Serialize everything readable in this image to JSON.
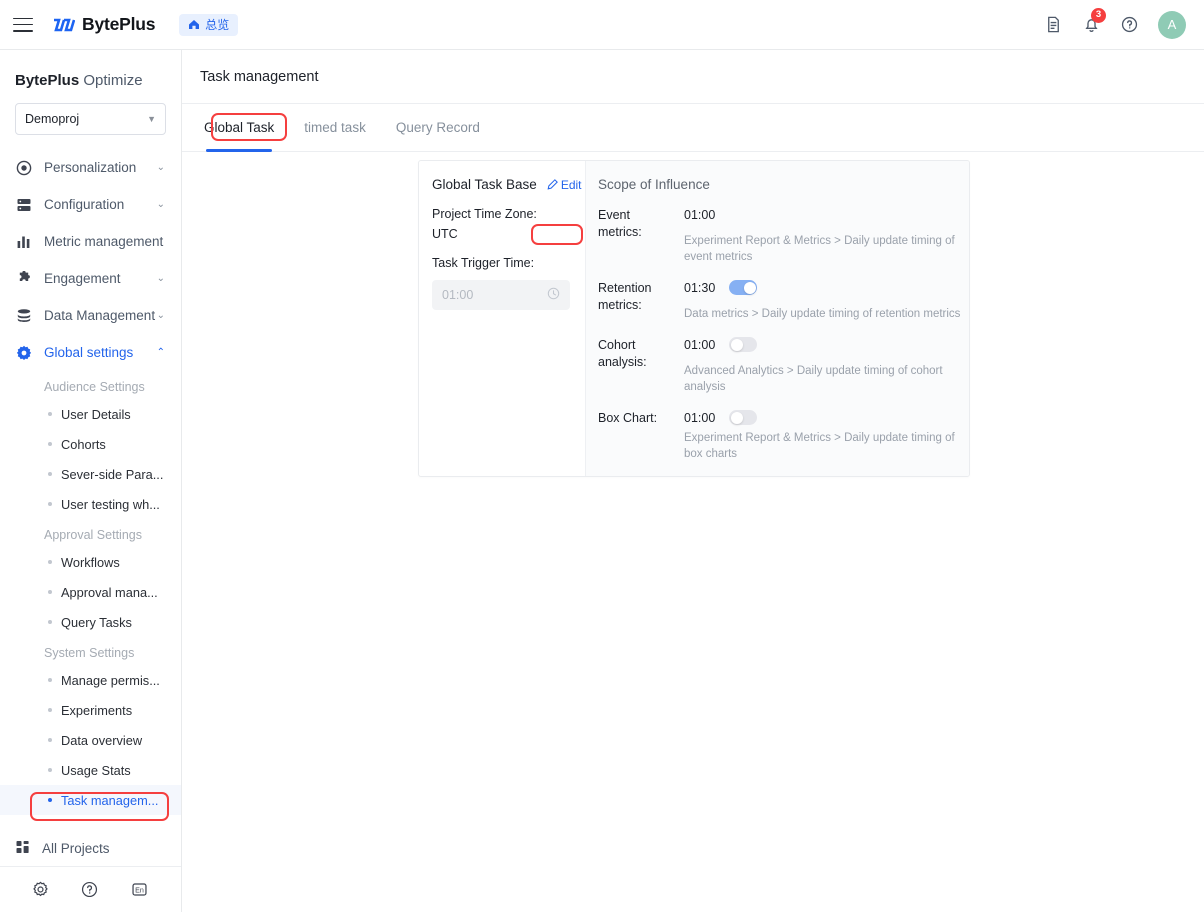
{
  "topbar": {
    "menu_icon": "hamburger-icon",
    "brand": "BytePlus",
    "overview_badge": "总览",
    "doc_icon": "document-icon",
    "bell_icon": "bell-icon",
    "notification_count": "3",
    "help_icon": "help-circle-icon",
    "avatar_initial": "A"
  },
  "sidebar": {
    "title_bold": "BytePlus",
    "title_rest": " Optimize",
    "project": "Demoproj",
    "nav": [
      {
        "label": "Personalization",
        "icon": "target-icon",
        "chevron": "⌄",
        "active": false
      },
      {
        "label": "Configuration",
        "icon": "server-icon",
        "chevron": "⌄",
        "active": false
      },
      {
        "label": "Metric management",
        "icon": "bar-chart-icon",
        "chevron": "",
        "active": false
      },
      {
        "label": "Engagement",
        "icon": "puzzle-icon",
        "chevron": "⌄",
        "active": false
      },
      {
        "label": "Data Management",
        "icon": "database-icon",
        "chevron": "⌄",
        "active": false
      },
      {
        "label": "Global settings",
        "icon": "gear-icon",
        "chevron": "⌃",
        "active": true
      }
    ],
    "groups": [
      {
        "label": "Audience Settings",
        "items": [
          {
            "label": "User Details",
            "selected": false
          },
          {
            "label": "Cohorts",
            "selected": false
          },
          {
            "label": "Sever-side Para...",
            "selected": false
          },
          {
            "label": "User testing wh...",
            "selected": false
          }
        ]
      },
      {
        "label": "Approval Settings",
        "items": [
          {
            "label": "Workflows",
            "selected": false
          },
          {
            "label": "Approval mana...",
            "selected": false
          },
          {
            "label": "Query Tasks",
            "selected": false
          }
        ]
      },
      {
        "label": "System Settings",
        "items": [
          {
            "label": "Manage permis...",
            "selected": false
          },
          {
            "label": "Experiments",
            "selected": false
          },
          {
            "label": "Data overview",
            "selected": false
          },
          {
            "label": "Usage Stats",
            "selected": false
          },
          {
            "label": "Task managem...",
            "selected": true
          }
        ]
      }
    ],
    "all_projects": "All Projects",
    "tools": [
      "gear-icon",
      "help-circle-icon",
      "language-en-icon"
    ]
  },
  "main": {
    "page_title": "Task management",
    "tabs": [
      {
        "label": "Global Task",
        "active": true
      },
      {
        "label": "timed task",
        "active": false
      },
      {
        "label": "Query Record",
        "active": false
      }
    ]
  },
  "card": {
    "left": {
      "title": "Global Task Base",
      "edit_label": "Edit",
      "timezone_label": "Project Time Zone:",
      "timezone_value": "UTC",
      "trigger_label": "Task Trigger Time:",
      "trigger_value": "01:00",
      "clock_icon": "clock-icon"
    },
    "right": {
      "title": "Scope of Influence",
      "rows": [
        {
          "name": "Event metrics:",
          "time": "01:00",
          "has_toggle": false,
          "toggle_on": false,
          "desc": "Experiment Report & Metrics > Daily update timing of event metrics"
        },
        {
          "name": "Retention metrics:",
          "time": "01:30",
          "has_toggle": true,
          "toggle_on": true,
          "desc": "Data metrics > Daily update timing of retention metrics"
        },
        {
          "name": "Cohort analysis:",
          "time": "01:00",
          "has_toggle": true,
          "toggle_on": false,
          "desc": "Advanced Analytics > Daily update timing of cohort analysis"
        },
        {
          "name": "Box Chart:",
          "time": "01:00",
          "has_toggle": true,
          "toggle_on": false,
          "desc": "Experiment Report & Metrics > Daily update timing of box charts"
        }
      ]
    }
  },
  "colors": {
    "accent": "#2364eb",
    "annotation": "#f53f3f",
    "toggle_on": "#86b0f3",
    "toggle_off": "#e5e6eb",
    "avatar": "#8fcbb5"
  }
}
